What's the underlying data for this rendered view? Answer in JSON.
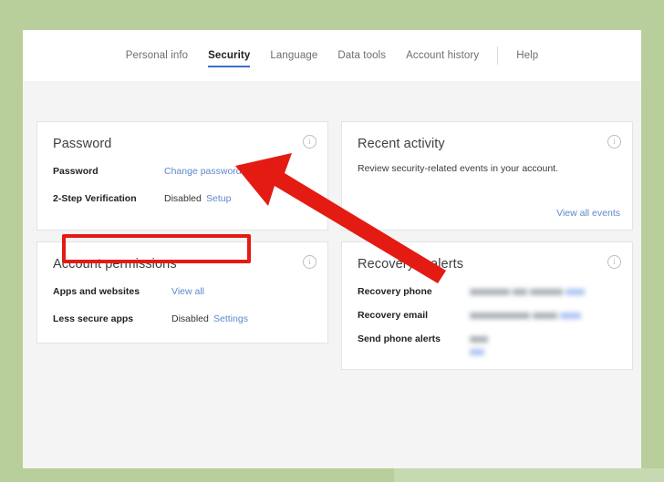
{
  "theme": {
    "page_background": "#b8cf9c",
    "content_background": "#f4f4f4",
    "card_background": "#ffffff",
    "link_color": "#5e87cf",
    "accent_underline": "#3b6fc4",
    "annotation_red": "#e31b13"
  },
  "tabs": [
    {
      "label": "Personal info",
      "active": false
    },
    {
      "label": "Security",
      "active": true
    },
    {
      "label": "Language",
      "active": false
    },
    {
      "label": "Data tools",
      "active": false
    },
    {
      "label": "Account history",
      "active": false
    },
    {
      "label": "Help",
      "active": false
    }
  ],
  "cards": {
    "password": {
      "title": "Password",
      "info_icon": "info-icon",
      "rows": [
        {
          "label": "Password",
          "value": "",
          "link": "Change password"
        },
        {
          "label": "2-Step Verification",
          "value": "Disabled",
          "link": "Setup"
        }
      ]
    },
    "recent_activity": {
      "title": "Recent activity",
      "info_icon": "info-icon",
      "description": "Review security-related events in your account.",
      "link": "View all events"
    },
    "account_permissions": {
      "title": "Account permissions",
      "info_icon": "info-icon",
      "rows": [
        {
          "label": "Apps and websites",
          "value": "",
          "link": "View all"
        },
        {
          "label": "Less secure apps",
          "value": "Disabled",
          "link": "Settings"
        }
      ]
    },
    "recovery_alerts": {
      "title": "Recovery & alerts",
      "info_icon": "info-icon",
      "rows": [
        {
          "label": "Recovery phone",
          "value": "",
          "link": ""
        },
        {
          "label": "Recovery email",
          "value": "",
          "link": ""
        },
        {
          "label": "Send phone alerts",
          "value": "",
          "link": ""
        }
      ]
    }
  },
  "annotations": {
    "highlight_target": "2-Step Verification row",
    "arrow": "red-arrow-pointing-up-left"
  }
}
